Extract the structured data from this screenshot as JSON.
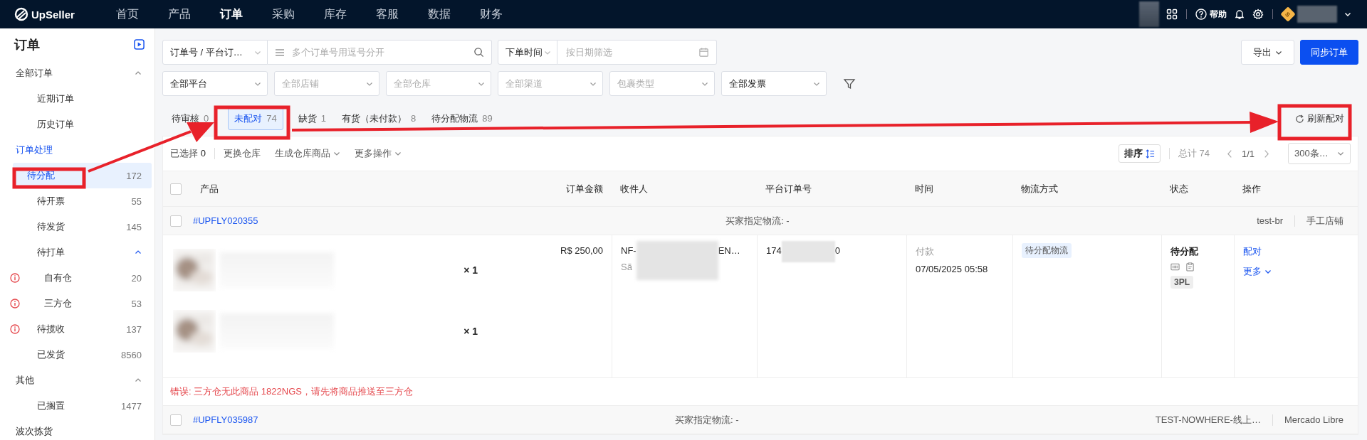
{
  "top_nav": {
    "logo": "UpSeller",
    "items": [
      {
        "label": "首页",
        "selected": false
      },
      {
        "label": "产品",
        "selected": false
      },
      {
        "label": "订单",
        "selected": true
      },
      {
        "label": "采购",
        "selected": false
      },
      {
        "label": "库存",
        "selected": false
      },
      {
        "label": "客服",
        "selected": false
      },
      {
        "label": "数据",
        "selected": false
      },
      {
        "label": "财务",
        "selected": false
      }
    ],
    "help": "帮助",
    "user_badge": "S"
  },
  "sidebar": {
    "title": "订单",
    "items": [
      {
        "kind": "group",
        "label": "全部订单",
        "expanded": true,
        "children": [
          {
            "label": "近期订单",
            "selected": false
          },
          {
            "label": "历史订单",
            "selected": false
          }
        ]
      },
      {
        "kind": "link",
        "label": "订单处理",
        "children": [
          {
            "label": "待分配",
            "count": "172",
            "selected": true
          },
          {
            "label": "待开票",
            "count": "55",
            "selected": false
          },
          {
            "label": "待发货",
            "count": "145",
            "selected": false
          },
          {
            "kind": "group",
            "label": "待打单",
            "expanded": true,
            "children": [
              {
                "label": "自有仓",
                "count": "20",
                "warning": true,
                "selected": false
              },
              {
                "label": "三方仓",
                "count": "53",
                "warning": true,
                "selected": false
              }
            ]
          },
          {
            "label": "待揽收",
            "count": "137",
            "warning": true,
            "selected": false
          },
          {
            "label": "已发货",
            "count": "8560",
            "selected": false
          }
        ]
      },
      {
        "kind": "group",
        "label": "其他",
        "expanded": true,
        "children": [
          {
            "label": "已搁置",
            "count": "1477",
            "selected": false
          }
        ]
      },
      {
        "kind": "heading",
        "label": "波次拣货"
      }
    ]
  },
  "filters": {
    "search_type": "订单号 / 平台订…",
    "search": {
      "placeholder": "多个订单号用逗号分开"
    },
    "time_type": "下单时间",
    "date": {
      "placeholder": "按日期筛选"
    },
    "selects": [
      {
        "value": "全部平台"
      },
      {
        "placeholder": "全部店铺"
      },
      {
        "placeholder": "全部仓库"
      },
      {
        "placeholder": "全部渠道"
      },
      {
        "placeholder": "包裹类型"
      },
      {
        "value": "全部发票"
      }
    ],
    "export": "导出",
    "sync": "同步订单"
  },
  "tabs": [
    {
      "label": "待审核",
      "count": "0",
      "selected": false
    },
    {
      "label": "未配对",
      "count": "74",
      "selected": true
    },
    {
      "label": "缺货",
      "count": "1",
      "selected": false
    },
    {
      "label": "有货（未付款）",
      "count": "8",
      "selected": false
    },
    {
      "label": "待分配物流",
      "count": "89",
      "selected": false
    }
  ],
  "refresh": "刷新配对",
  "toolbar": {
    "selected_label": "已选择",
    "selected_count": "0",
    "actions": [
      {
        "label": "更换仓库",
        "dropdown": false
      },
      {
        "label": "生成仓库商品",
        "dropdown": true
      },
      {
        "label": "更多操作",
        "dropdown": true
      }
    ],
    "sort": "排序",
    "total": "总计 74",
    "page": "1/1",
    "page_size": "300条…"
  },
  "table": {
    "all_checked": false,
    "columns": [
      "产品",
      "订单金额",
      "收件人",
      "平台订单号",
      "时间",
      "物流方式",
      "状态",
      "操作"
    ],
    "orders": [
      {
        "checked": false,
        "id": "#UPFLY020355",
        "buyer_logistics": "买家指定物流: -",
        "store": "test-br",
        "platform": "手工店铺",
        "items": [
          {
            "quantity": "× 1"
          },
          {
            "quantity": "× 1"
          }
        ],
        "amount": "R$ 250,00",
        "recipient": {
          "name_start": "NF-",
          "name_end": "EN…",
          "city": "Sã"
        },
        "platform_order": {
          "start": "174",
          "end": "0"
        },
        "time_label": "付款",
        "time": "07/05/2025 05:58",
        "logistics_tag": "待分配物流",
        "status": "待分配",
        "status_tag": "3PL",
        "actions": [
          {
            "label": "配对",
            "dropdown": false
          },
          {
            "label": "更多",
            "dropdown": true
          }
        ],
        "error": "错误: 三方仓无此商品 1822NGS，请先将商品推送至三方仓"
      },
      {
        "checked": false,
        "id": "#UPFLY035987",
        "buyer_logistics": "买家指定物流: -",
        "store": "TEST-NOWHERE-线上…",
        "platform": "Mercado Libre"
      }
    ]
  }
}
